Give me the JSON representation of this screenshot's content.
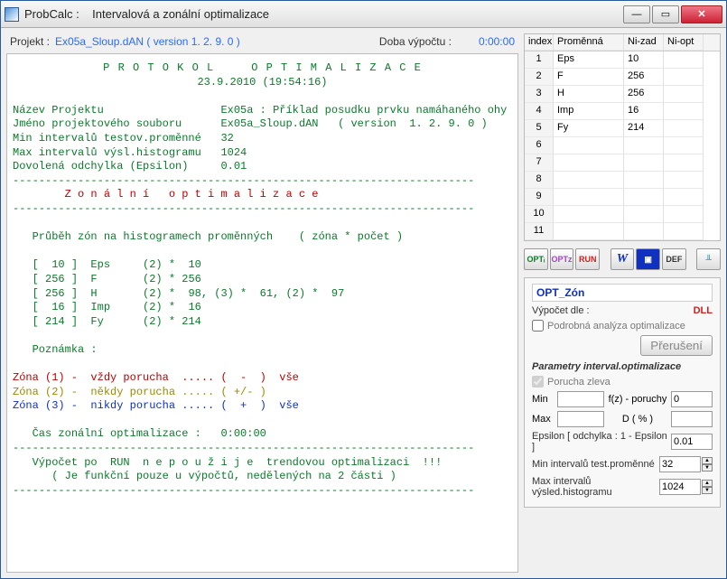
{
  "window": {
    "app": "ProbCalc :",
    "title": "Intervalová a zonální optimalizace"
  },
  "toprow": {
    "projekt_lbl": "Projekt :",
    "projekt_val": "Ex05a_Sloup.dAN  ( version  1. 2. 9. 0 )",
    "doba_lbl": "Doba výpočtu :",
    "doba_val": "0:00:00"
  },
  "protocol": {
    "heading": "P R O T O K O L     O P T I M A L I Z A C E",
    "date": "23.9.2010 (19:54:16)",
    "l1a": "Název Projektu",
    "l1b": "Ex05a : Příklad posudku prvku namáhaného ohy",
    "l2a": "Jméno projektového souboru",
    "l2b": "Ex05a_Sloup.dAN   ( version  1. 2. 9. 0 )",
    "l3a": "Min intervalů testov.proměnné",
    "l3b": "32",
    "l4a": "Max intervalů výsl.histogramu",
    "l4b": "1024",
    "l5a": "Dovolená odchylka (Epsilon)",
    "l5b": "0.01",
    "dashes": "-----------------------------------------------------------------------",
    "zon_title": "Z o n á l n í   o p t i m a l i z a c e",
    "pruhbeh": "Průběh zón na histogramech proměnných    ( zóna * počet )",
    "z1": "[  10 ]  Eps     (2) *  10",
    "z2": "[ 256 ]  F       (2) * 256",
    "z3": "[ 256 ]  H       (2) *  98, (3) *  61, (2) *  97",
    "z4": "[  16 ]  Imp     (2) *  16",
    "z5": "[ 214 ]  Fy      (2) * 214",
    "pozn": "Poznámka :",
    "note1": "Zóna (1) -  vždy porucha  ..... (  -  )  vše",
    "note2": "Zóna (2) -  někdy porucha ..... ( +/- )",
    "note3": "Zóna (3) -  nikdy porucha ..... (  +  )  vše",
    "cas": "Čas zonální optimalizace :   0:00:00",
    "warn1": "Výpočet po  RUN  n e p o u ž i j e  trendovou optimalizaci  !!!",
    "warn2": "( Je funkční pouze u výpočtů, nedělených na 2 části )"
  },
  "grid": {
    "headers": {
      "idx": "index",
      "var": "Proměnná",
      "ni": "Ni-zad",
      "niop": "Ni-opt"
    },
    "rows": [
      {
        "idx": "1",
        "var": "Eps",
        "ni": "10",
        "niop": ""
      },
      {
        "idx": "2",
        "var": "F",
        "ni": "256",
        "niop": ""
      },
      {
        "idx": "3",
        "var": "H",
        "ni": "256",
        "niop": ""
      },
      {
        "idx": "4",
        "var": "Imp",
        "ni": "16",
        "niop": ""
      },
      {
        "idx": "5",
        "var": "Fy",
        "ni": "214",
        "niop": ""
      },
      {
        "idx": "6",
        "var": "",
        "ni": "",
        "niop": ""
      },
      {
        "idx": "7",
        "var": "",
        "ni": "",
        "niop": ""
      },
      {
        "idx": "8",
        "var": "",
        "ni": "",
        "niop": ""
      },
      {
        "idx": "9",
        "var": "",
        "ni": "",
        "niop": ""
      },
      {
        "idx": "10",
        "var": "",
        "ni": "",
        "niop": ""
      },
      {
        "idx": "11",
        "var": "",
        "ni": "",
        "niop": ""
      }
    ]
  },
  "btns": {
    "opt1": "OPTᵢ",
    "opt2": "OPTz",
    "run": "RUN",
    "w": "W",
    "save": "💾",
    "def": "DEF",
    "last": "⬛"
  },
  "panel": {
    "optzon": "OPT_Zón",
    "vypocet_lbl": "Výpočet dle :",
    "vypocet_val": "DLL",
    "podrobna": "Podrobná analýza optimalizace",
    "preruseni": "Přerušení",
    "params_title": "Parametry interval.optimalizace",
    "porucha": "Porucha zleva",
    "min_lbl": "Min",
    "max_lbl": "Max",
    "fz_lbl": "f(z) - poruchy",
    "fz_val": "0",
    "d_lbl": "D ( % )",
    "d_val": "",
    "eps_lbl": "Epsilon [ odchylka : 1 - Epsilon ]",
    "eps_val": "0.01",
    "mintest_lbl": "Min  intervalů test.proměnné",
    "mintest_val": "32",
    "maxhist_lbl": "Max intervalů výsled.histogramu",
    "maxhist_val": "1024"
  }
}
